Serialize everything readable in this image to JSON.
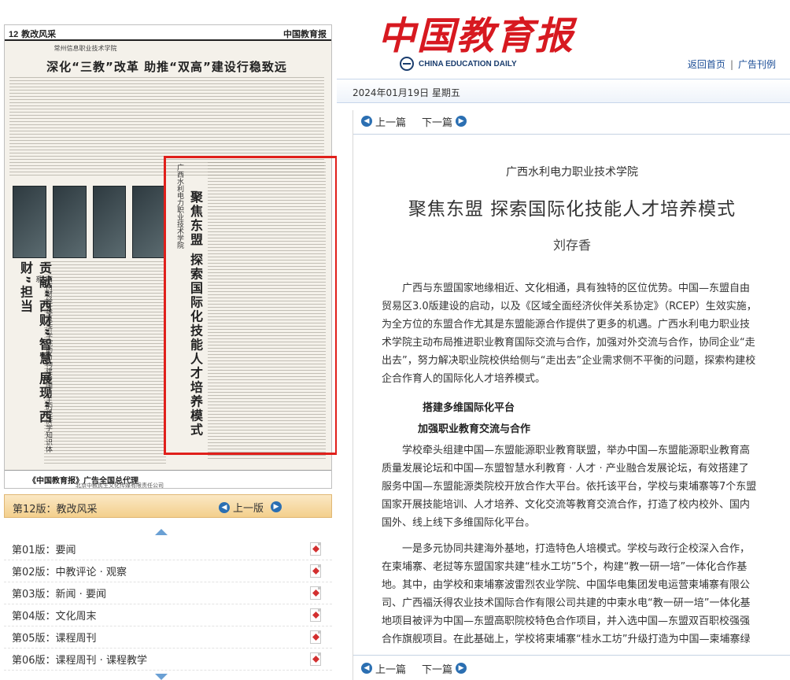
{
  "paper": {
    "page_number": "12",
    "section": "教改风采",
    "top_thin_title": "常州信息职业技术学院",
    "headline": "深化“三教”改革 助推“双高”建设行稳致远",
    "masthead_small": "中国教育报",
    "vertical_title": "聚焦东盟 探索国际化技能人才培养模式",
    "vertical_org": "广西水利电力职业技术学院",
    "left_vertical_headline": "贡献“西财”智慧 展现“西财”担当",
    "left_vertical_sub": "西南财经大学经济学院助力构建中国自主的经济学知识体系",
    "ad_line": "《中国教育报》广告全国总代理",
    "ad_sub": "北京中教民生文化传媒有限责任公司"
  },
  "page_bar": {
    "label": "第12版：教改风采",
    "prev_label": "上一版"
  },
  "editions": [
    {
      "label": "第01版：要闻"
    },
    {
      "label": "第02版：中教评论 · 观察"
    },
    {
      "label": "第03版：新闻 · 要闻"
    },
    {
      "label": "第04版：文化周末"
    },
    {
      "label": "第05版：课程周刊"
    },
    {
      "label": "第06版：课程周刊 · 课程教学"
    }
  ],
  "masthead": {
    "logo_text": "中国教育报",
    "english_name": "CHINA EDUCATION DAILY",
    "links": {
      "home": "返回首页",
      "sep": "|",
      "ads": "广告刊例"
    }
  },
  "date": "2024年01月19日  星期五",
  "nav": {
    "prev": "上一篇",
    "next": "下一篇"
  },
  "article": {
    "org": "广西水利电力职业技术学院",
    "title": "聚焦东盟  探索国际化技能人才培养模式",
    "author": "刘存香",
    "p1": "广西与东盟国家地缘相近、文化相通，具有独特的区位优势。中国—东盟自由贸易区3.0版建设的启动，以及《区域全面经济伙伴关系协定》（RCEP）生效实施，为全方位的东盟合作尤其是东盟能源合作提供了更多的机遇。广西水利电力职业技术学院主动布局推进职业教育国际交流与合作，加强对外交流与合作，协同企业“走出去”，努力解决职业院校供给侧与“走出去”企业需求侧不平衡的问题，探索构建校企合作育人的国际化人才培养模式。",
    "h1": "搭建多维国际化平台",
    "h2": "加强职业教育交流与合作",
    "p2": "学校牵头组建中国—东盟能源职业教育联盟，举办中国—东盟能源职业教育高质量发展论坛和中国—东盟智慧水利教育 · 人才 · 产业融合发展论坛，有效搭建了服务中国—东盟能源类院校开放合作大平台。依托该平台，学校与柬埔寨等7个东盟国家开展技能培训、人才培养、文化交流等教育交流合作，打造了校内校外、国内国外、线上线下多维国际化平台。",
    "p3": "一是多元协同共建海外基地，打造特色人培模式。学校与政行企校深入合作，在柬埔寨、老挝等东盟国家共建“桂水工坊”5个，构建“教一研一培”一体化合作基地。其中，由学校和柬埔寨波雷烈农业学院、中国华电集团发电运营柬埔寨有限公司、广西福沃得农业技术国际合作有限公司共建的中柬水电“教一研一培”一体化基地项目被评为中国—东盟高职院校特色合作项目，并入选中国—东盟双百职校强强合作旗舰项目。在此基础上，学校将柬埔寨“桂水工坊”升级打造为中国—柬埔寨绿色能源现代工匠学院。"
  }
}
